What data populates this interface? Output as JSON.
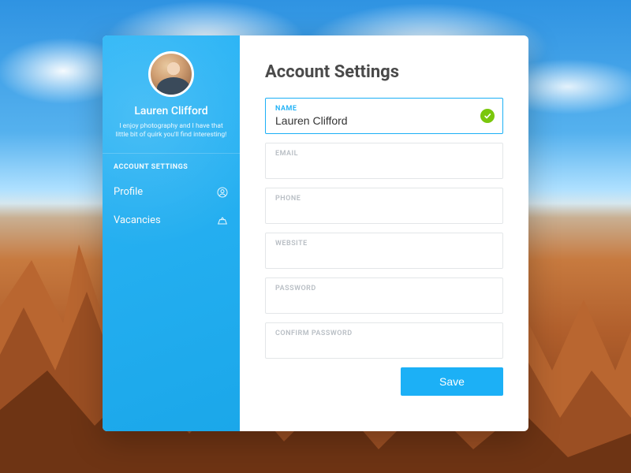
{
  "sidebar": {
    "user_name": "Lauren Clifford",
    "user_bio": "I enjoy photography and I have that little bit of quirk you'll find interesting!",
    "section_label": "ACCOUNT SETTINGS",
    "nav": [
      {
        "label": "Profile",
        "icon": "user-circle-icon"
      },
      {
        "label": "Vacancies",
        "icon": "cake-icon"
      }
    ]
  },
  "main": {
    "title": "Account Settings",
    "fields": [
      {
        "label": "NAME",
        "value": "Lauren Clifford",
        "active": true,
        "valid": true
      },
      {
        "label": "EMAIL",
        "value": ""
      },
      {
        "label": "PHONE",
        "value": ""
      },
      {
        "label": "WEBSITE",
        "value": ""
      },
      {
        "label": "PASSWORD",
        "value": ""
      },
      {
        "label": "CONFIRM PASSWORD",
        "value": ""
      }
    ],
    "save_label": "Save"
  },
  "colors": {
    "accent": "#1cb0f6",
    "success": "#7ac70c"
  }
}
